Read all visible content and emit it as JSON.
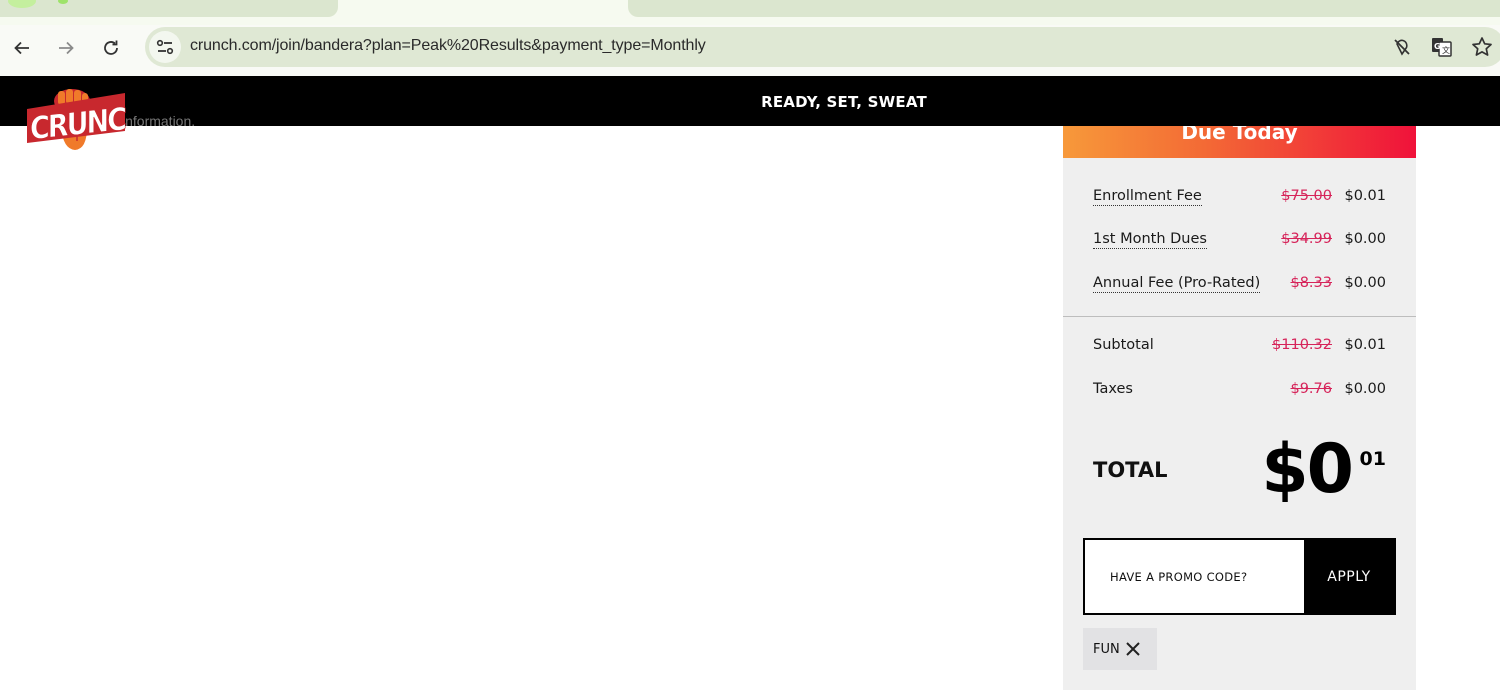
{
  "browser": {
    "url": "crunch.com/join/bandera?plan=Peak%20Results&payment_type=Monthly",
    "icons": {
      "back": "arrow-left-icon",
      "forward": "arrow-right-icon",
      "reload": "reload-icon",
      "site_info": "tune-icon",
      "tracking": "eye-off-icon",
      "translate": "translate-icon",
      "bookmark": "star-icon"
    }
  },
  "header": {
    "slogan": "READY, SET, SWEAT",
    "logo_text": "CRUNCH",
    "partially_hidden_text": "information."
  },
  "summary": {
    "title": "Due Today",
    "fees": [
      {
        "label": "Enrollment Fee",
        "original": "$75.00",
        "price": "$0.01"
      },
      {
        "label": "1st Month Dues",
        "original": "$34.99",
        "price": "$0.00"
      },
      {
        "label": "Annual Fee (Pro-Rated)",
        "original": "$8.33",
        "price": "$0.00"
      }
    ],
    "subtotal": {
      "label": "Subtotal",
      "original": "$110.32",
      "price": "$0.01"
    },
    "taxes": {
      "label": "Taxes",
      "original": "$9.76",
      "price": "$0.00"
    },
    "total": {
      "label": "TOTAL",
      "dollars": "$0",
      "cents": "01"
    },
    "promo": {
      "placeholder": "HAVE A PROMO CODE?",
      "value": "",
      "apply_label": "APPLY",
      "applied_code": "FUN"
    }
  },
  "colors": {
    "strike_price": "#d6245a",
    "gradient_start": "#f7993a",
    "gradient_end": "#f0123a",
    "panel_bg": "#efefef"
  }
}
